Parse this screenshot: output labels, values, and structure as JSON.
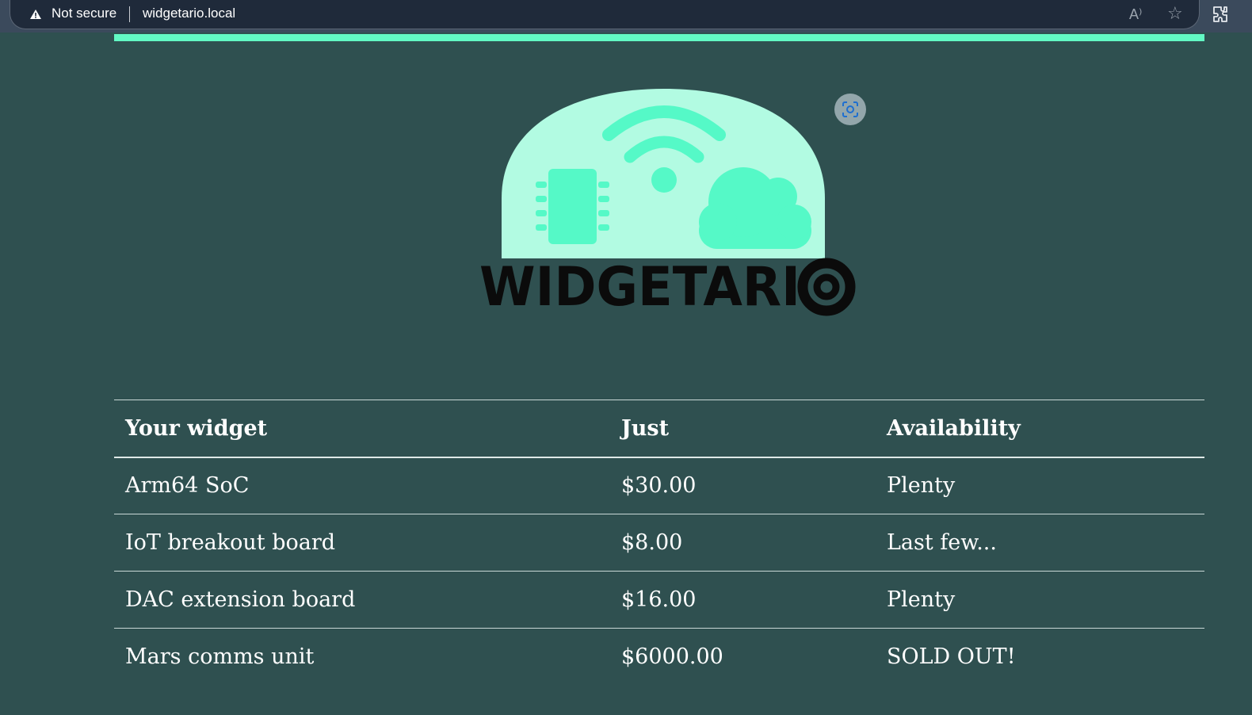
{
  "browser": {
    "security_label": "Not secure",
    "url": "widgetario.local",
    "read_aloud_label": "A⁾",
    "icons": [
      "warning-icon",
      "read-aloud-icon",
      "favorite-star-icon",
      "extensions-icon"
    ]
  },
  "logo": {
    "wordmark": "WIDGETARIO",
    "colors": {
      "dome": "#b2fbe2",
      "accent": "#55f9c7",
      "text": "#0b0b0b"
    }
  },
  "theme": {
    "background": "#2f5050",
    "accent_bar": "#62f9c4"
  },
  "table": {
    "headers": [
      "Your widget",
      "Just",
      "Availability"
    ],
    "rows": [
      {
        "widget": "Arm64 SoC",
        "price": "$30.00",
        "availability": "Plenty"
      },
      {
        "widget": "IoT breakout board",
        "price": "$8.00",
        "availability": "Last few..."
      },
      {
        "widget": "DAC extension board",
        "price": "$16.00",
        "availability": "Plenty"
      },
      {
        "widget": "Mars comms unit",
        "price": "$6000.00",
        "availability": "SOLD OUT!"
      }
    ]
  }
}
